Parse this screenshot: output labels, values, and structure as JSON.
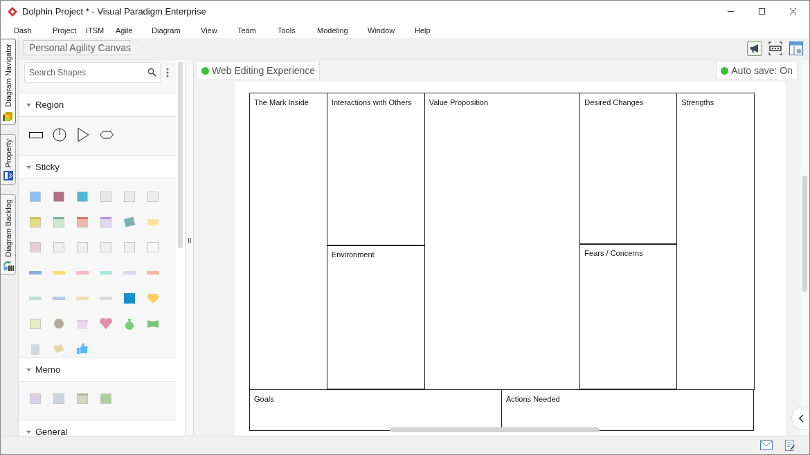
{
  "window": {
    "title": "Dolphin Project * - Visual Paradigm Enterprise"
  },
  "menu": [
    "Dash",
    "Project",
    "ITSM",
    "Agile",
    "Diagram",
    "View",
    "Team",
    "Tools",
    "Modeling",
    "Window",
    "Help"
  ],
  "side_tabs": [
    {
      "label": "Diagram Navigator",
      "selected": true
    },
    {
      "label": "Property",
      "selected": false
    },
    {
      "label": "Diagram Backlog",
      "selected": false
    }
  ],
  "breadcrumb": "Personal Agility Canvas",
  "palette": {
    "search": {
      "placeholder": "Search Shapes"
    },
    "sections": [
      {
        "title": "Region",
        "kind": "region",
        "expanded": true
      },
      {
        "title": "Sticky",
        "kind": "sticky",
        "expanded": true
      },
      {
        "title": "Memo",
        "kind": "memo",
        "expanded": true
      },
      {
        "title": "General",
        "kind": "general",
        "expanded": true
      }
    ]
  },
  "canvas": {
    "status_left": "Web Editing Experience",
    "status_right": "Auto save: On",
    "cells": [
      "The Mark Inside",
      "Interactions with Others",
      "Environment",
      "Value Proposition",
      "Desired Changes",
      "Fears / Concerns",
      "Strengths",
      "Goals",
      "Actions Needed"
    ]
  }
}
